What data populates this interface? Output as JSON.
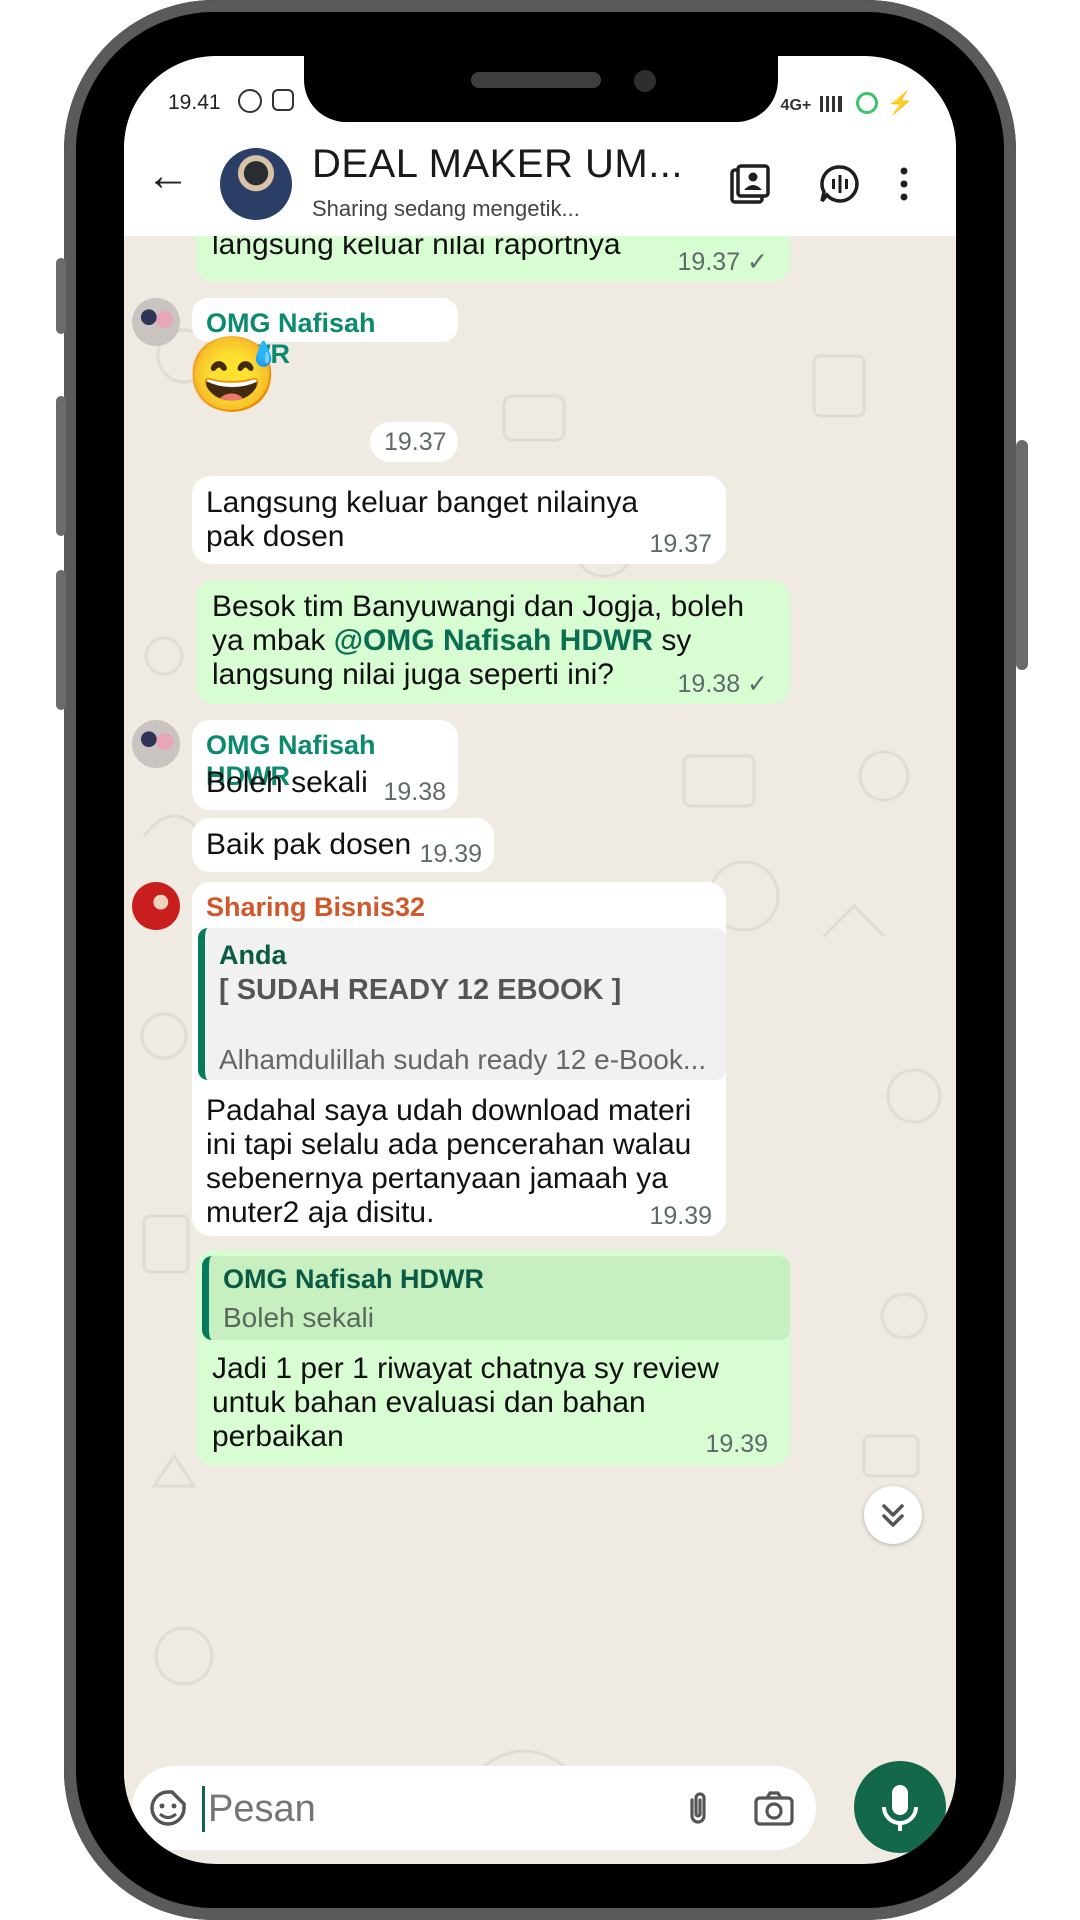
{
  "status_bar": {
    "time": "19.41",
    "network": "4G+"
  },
  "header": {
    "title": "DEAL MAKER UM...",
    "subtitle": "Sharing sedang mengetik..."
  },
  "messages": {
    "m0_text": "langsung keluar nilai raportnya",
    "m0_time": "19.37 ✓",
    "m1_sender": "OMG Nafisah HDWR",
    "m1_emoji": "😅",
    "m1_time": "19.37",
    "m2_text": "Langsung keluar banget nilainya pak dosen",
    "m2_time": "19.37",
    "m3_text_before": "Besok tim Banyuwangi dan Jogja, boleh ya mbak ",
    "m3_mention": "@OMG Nafisah HDWR",
    "m3_text_after": " sy langsung nilai juga seperti ini?",
    "m3_time": "19.38 ✓",
    "m4_sender": "OMG Nafisah HDWR",
    "m4_text": "Boleh sekali",
    "m4_time": "19.38",
    "m5_text": "Baik pak dosen",
    "m5_time": "19.39",
    "m6_sender": "Sharing Bisnis32",
    "m6_quote_author": "Anda",
    "m6_quote_title": "[ SUDAH READY 12 EBOOK ]",
    "m6_quote_body": "Alhamdulillah sudah ready 12 e-Book...",
    "m6_text": "Padahal saya udah download materi ini tapi selalu ada pencerahan walau sebenernya pertanyaan jamaah ya muter2 aja disitu.",
    "m6_time": "19.39",
    "m7_quote_author": "OMG Nafisah HDWR",
    "m7_quote_body": "Boleh sekali",
    "m7_text": "Jadi 1 per 1 riwayat chatnya sy review untuk bahan evaluasi dan bahan perbaikan",
    "m7_time": "19.39"
  },
  "composer": {
    "placeholder": "Pesan"
  },
  "colors": {
    "outgoing": "#d9fdd3",
    "incoming": "#ffffff",
    "accent": "#13684a",
    "sender_green": "#0b8a6e",
    "sender_orange": "#d0582a"
  }
}
